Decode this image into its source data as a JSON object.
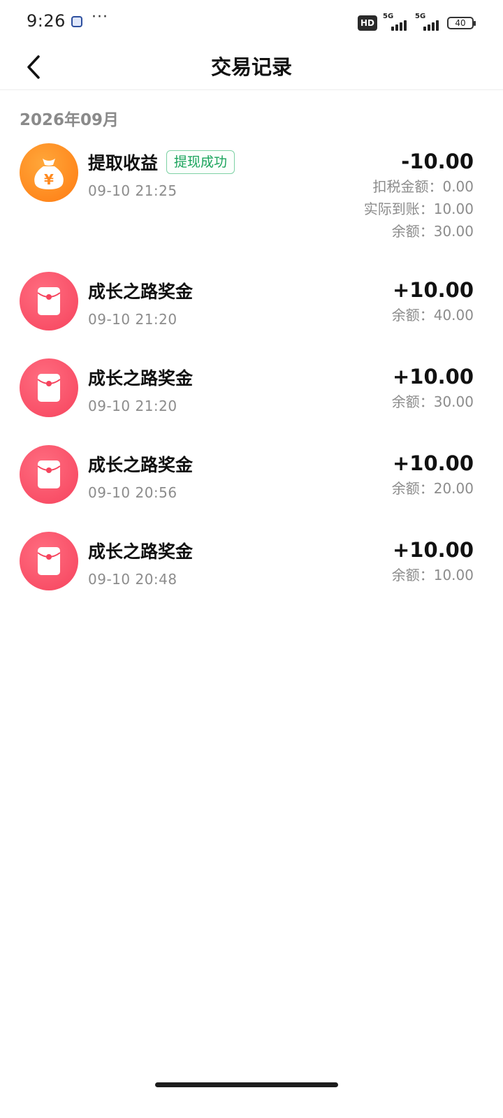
{
  "status_bar": {
    "time": "9:26",
    "dots": "···",
    "hd_label": "HD",
    "network_1": "5G",
    "network_2": "5G",
    "battery": "40"
  },
  "header": {
    "title": "交易记录",
    "back_icon": "chevron-left-icon"
  },
  "section": {
    "month": "2026年09月"
  },
  "records": [
    {
      "icon": "money-bag-icon",
      "title": "提取收益",
      "tag": "提现成功",
      "time": "09-10 21:25",
      "amount": "-10.00",
      "tax": "扣税金额：0.00",
      "actual": "实际到账：10.00",
      "balance": "余额：30.00"
    },
    {
      "icon": "red-envelope-icon",
      "title": "成长之路奖金",
      "time": "09-10 21:20",
      "amount": "+10.00",
      "balance": "余额：40.00"
    },
    {
      "icon": "red-envelope-icon",
      "title": "成长之路奖金",
      "time": "09-10 21:20",
      "amount": "+10.00",
      "balance": "余额：30.00"
    },
    {
      "icon": "red-envelope-icon",
      "title": "成长之路奖金",
      "time": "09-10 20:56",
      "amount": "+10.00",
      "balance": "余额：20.00"
    },
    {
      "icon": "red-envelope-icon",
      "title": "成长之路奖金",
      "time": "09-10 20:48",
      "amount": "+10.00",
      "balance": "余额：10.00"
    }
  ],
  "colors": {
    "tag_green": "#1aa35b",
    "orange_icon": "#ff8a1f",
    "red_icon": "#f6435d",
    "muted_text": "#8c8c8c"
  }
}
